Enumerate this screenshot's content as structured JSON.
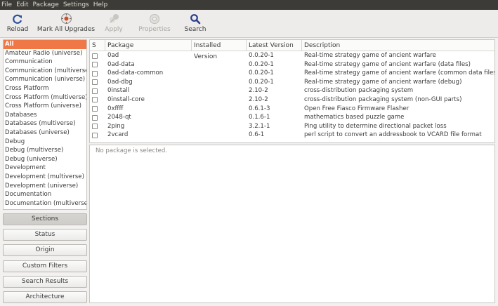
{
  "menu": [
    "File",
    "Edit",
    "Package",
    "Settings",
    "Help"
  ],
  "toolbar": {
    "reload": "Reload",
    "mark_all": "Mark All Upgrades",
    "apply": "Apply",
    "properties": "Properties",
    "search": "Search"
  },
  "sections": [
    "All",
    "Amateur Radio (universe)",
    "Communication",
    "Communication (multiverse)",
    "Communication (universe)",
    "Cross Platform",
    "Cross Platform (multiverse)",
    "Cross Platform (universe)",
    "Databases",
    "Databases (multiverse)",
    "Databases (universe)",
    "Debug",
    "Debug (multiverse)",
    "Debug (universe)",
    "Development",
    "Development (multiverse)",
    "Development (universe)",
    "Documentation",
    "Documentation (multiverse)"
  ],
  "filter_buttons": [
    "Sections",
    "Status",
    "Origin",
    "Custom Filters",
    "Search Results",
    "Architecture"
  ],
  "columns": [
    "S",
    "Package",
    "Installed Version",
    "Latest Version",
    "Description"
  ],
  "packages": [
    {
      "name": "0ad",
      "installed": "",
      "latest": "0.0.20-1",
      "desc": "Real-time strategy game of ancient warfare"
    },
    {
      "name": "0ad-data",
      "installed": "",
      "latest": "0.0.20-1",
      "desc": "Real-time strategy game of ancient warfare (data files)"
    },
    {
      "name": "0ad-data-common",
      "installed": "",
      "latest": "0.0.20-1",
      "desc": "Real-time strategy game of ancient warfare (common data files)"
    },
    {
      "name": "0ad-dbg",
      "installed": "",
      "latest": "0.0.20-1",
      "desc": "Real-time strategy game of ancient warfare (debug)"
    },
    {
      "name": "0install",
      "installed": "",
      "latest": "2.10-2",
      "desc": "cross-distribution packaging system"
    },
    {
      "name": "0install-core",
      "installed": "",
      "latest": "2.10-2",
      "desc": "cross-distribution packaging system (non-GUI parts)"
    },
    {
      "name": "0xffff",
      "installed": "",
      "latest": "0.6.1-3",
      "desc": "Open Free Fiasco Firmware Flasher"
    },
    {
      "name": "2048-qt",
      "installed": "",
      "latest": "0.1.6-1",
      "desc": "mathematics based puzzle game"
    },
    {
      "name": "2ping",
      "installed": "",
      "latest": "3.2.1-1",
      "desc": "Ping utility to determine directional packet loss"
    },
    {
      "name": "2vcard",
      "installed": "",
      "latest": "0.6-1",
      "desc": "perl script to convert an addressbook to VCARD file format"
    }
  ],
  "details": {
    "empty": "No package is selected."
  },
  "colors": {
    "selection": "#f07746",
    "menubar": "#3c3b37",
    "accent_search": "#2a3e8c"
  },
  "icons": {
    "reload": "reload-icon",
    "mark_all": "mark-upgrades-icon",
    "apply": "apply-icon",
    "properties": "properties-icon",
    "search": "search-icon"
  }
}
